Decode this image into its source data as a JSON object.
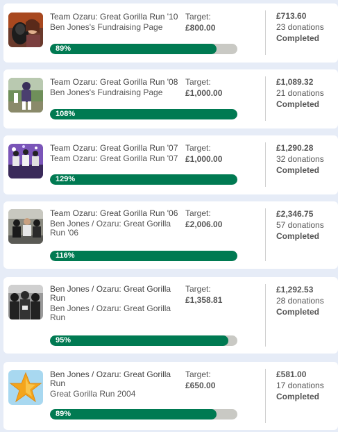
{
  "colors": {
    "page_background": "#e6ecf7",
    "card_background": "#ffffff",
    "progress_fill": "#007a52",
    "progress_track": "#c9c9c4"
  },
  "pages": [
    {
      "title": "Team Ozaru: Great Gorilla Run '10",
      "subtitle": "Ben Jones's Fundraising Page",
      "target_label": "Target:",
      "target_amount": "£800.00",
      "raised": "£713.60",
      "donations": "23 donations",
      "status": "Completed",
      "progress_label": "89%",
      "progress_value": 0.89,
      "image": "person-in-gorilla-costume-photo"
    },
    {
      "title": "Team Ozaru: Great Gorilla Run '08",
      "subtitle": "Ben Jones's Fundraising Page",
      "target_label": "Target:",
      "target_amount": "£1,000.00",
      "raised": "£1,089.32",
      "donations": "21 donations",
      "status": "Completed",
      "progress_label": "108%",
      "progress_value": 1.0,
      "image": "gorilla-costume-runner-photo"
    },
    {
      "title": "Team Ozaru: Great Gorilla Run '07",
      "subtitle": "Team Ozaru: Great Gorilla Run '07",
      "target_label": "Target:",
      "target_amount": "£1,000.00",
      "raised": "£1,290.28",
      "donations": "32 donations",
      "status": "Completed",
      "progress_label": "129%",
      "progress_value": 1.0,
      "image": "team-on-purple-stage-photo"
    },
    {
      "title": "Team Ozaru: Great Gorilla Run '06",
      "subtitle": "Ben Jones / Ozaru: Great Gorilla Run '06",
      "target_label": "Target:",
      "target_amount": "£2,006.00",
      "raised": "£2,346.75",
      "donations": "57 donations",
      "status": "Completed",
      "progress_label": "116%",
      "progress_value": 1.0,
      "image": "gorilla-runners-street-photo"
    },
    {
      "title": "Ben Jones / Ozaru: Great Gorilla Run",
      "subtitle": "Ben Jones / Ozaru: Great Gorilla Run",
      "target_label": "Target:",
      "target_amount": "£1,358.81",
      "raised": "£1,292.53",
      "donations": "28 donations",
      "status": "Completed",
      "progress_label": "95%",
      "progress_value": 0.95,
      "image": "gorilla-crowd-black-white-photo"
    },
    {
      "title": "Ben Jones / Ozaru: Great Gorilla Run",
      "subtitle": "Great Gorilla Run 2004",
      "target_label": "Target:",
      "target_amount": "£650.00",
      "raised": "£581.00",
      "donations": "17 donations",
      "status": "Completed",
      "progress_label": "89%",
      "progress_value": 0.89,
      "image": "star-icon"
    }
  ]
}
